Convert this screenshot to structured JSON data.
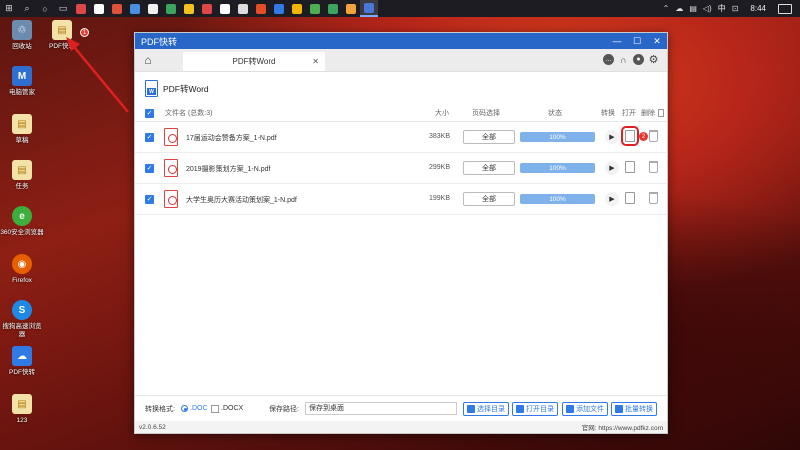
{
  "taskbar": {
    "apps_colors": [
      "#e04848",
      "#ffffff",
      "#e0513a",
      "#4a90e2",
      "#f0f0f0",
      "#3ba55d",
      "#f3c220",
      "#e04848",
      "#ffffff",
      "#dddddd",
      "#e44d26",
      "#2f7ae5",
      "#f4b400",
      "#4caf50",
      "#3ba55d",
      "#f2a33a",
      "#4a78d8"
    ],
    "active_index": 16,
    "ime": "中",
    "time": "8:44"
  },
  "desktop": {
    "icons": [
      {
        "label": "回收站",
        "icon": "recycle-bin-icon",
        "color": "#6b8cae"
      },
      {
        "label": "PDF快转",
        "icon": "pdf-file-icon",
        "color": "#e8c25a"
      },
      {
        "label": "电脑管家",
        "icon": "pc-manager-icon",
        "color": "#2f6fd1"
      },
      {
        "label": "草稿",
        "icon": "draft-file-icon",
        "color": "#e8c25a"
      },
      {
        "label": "任务",
        "icon": "task-file-icon",
        "color": "#e8c25a"
      },
      {
        "label": "360安全浏览器",
        "icon": "browser-360-icon",
        "color": "#3cae3c"
      },
      {
        "label": "Firefox",
        "icon": "firefox-icon",
        "color": "#e66000"
      },
      {
        "label": "搜狗高速浏览器",
        "icon": "sogou-browser-icon",
        "color": "#1e88e5"
      },
      {
        "label": "PDF快转",
        "icon": "pdf-convert-app-icon",
        "color": "#2f7ae5"
      },
      {
        "label": "123",
        "icon": "folder-file-icon",
        "color": "#e8c25a"
      }
    ],
    "badge": "1"
  },
  "window": {
    "title": "PDF快转",
    "tab_label": "PDF转Word",
    "tab_close": "✕",
    "section_title": "PDF转Word",
    "columns": {
      "filename": "文件名 (总数:3)",
      "size": "大小",
      "range": "页码选择",
      "status": "状态",
      "convert": "转换",
      "open": "打开",
      "delete": "删除"
    },
    "files": [
      {
        "name": "17届运动会赞备方案_1-N.pdf",
        "size": "383KB",
        "range": "全部",
        "progress": "100%",
        "highlight": true
      },
      {
        "name": "2019摄影策划方案_1-N.pdf",
        "size": "299KB",
        "range": "全部",
        "progress": "100%",
        "highlight": false
      },
      {
        "name": "大学生奥历大赛活动策划案_1-N.pdf",
        "size": "199KB",
        "range": "全部",
        "progress": "100%",
        "highlight": false
      }
    ],
    "row_badge": "2",
    "footer": {
      "format_label": "转换格式:",
      "fmt_doc": ".DOC",
      "fmt_docx": ".DOCX",
      "path_label": "保存路径:",
      "path_value": "保存到桌面",
      "btn_choose": "选择目录",
      "btn_open": "打开目录",
      "btn_add": "添加文件",
      "btn_batch": "批量转换"
    },
    "status": {
      "version": "v2.0.6.52",
      "site": "官网: https://www.pdfkz.com"
    }
  },
  "colors": {
    "accent": "#2f7ae5",
    "titlebar": "#2867c8",
    "highlight": "#e02020"
  }
}
